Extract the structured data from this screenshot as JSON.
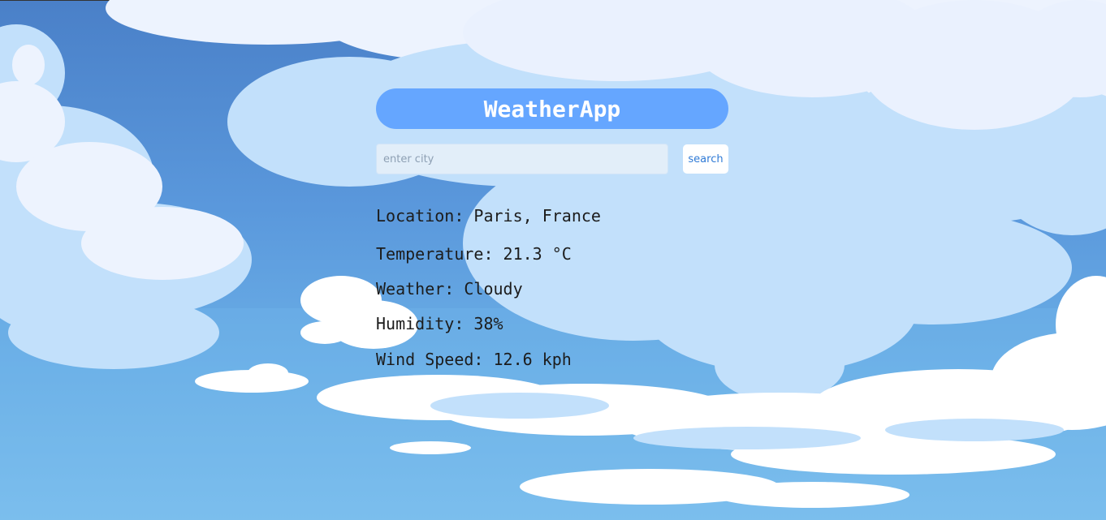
{
  "app": {
    "title": "WeatherApp"
  },
  "search": {
    "placeholder": "enter city",
    "value": "",
    "button_label": "search"
  },
  "weather": {
    "location_label": "Location:",
    "location_value": "Paris, France",
    "temperature_label": "Temperature:",
    "temperature_value": "21.3 °C",
    "condition_label": "Weather:",
    "condition_value": "Cloudy",
    "humidity_label": "Humidity:",
    "humidity_value": "38%",
    "wind_label": "Wind Speed:",
    "wind_value": "12.6 kph"
  },
  "colors": {
    "sky_top": "#4a80c8",
    "sky_bottom": "#80c2ef",
    "cloud_light": "#c2e0fb",
    "cloud_white": "#edf3fe",
    "title_bar": "#5a9bff",
    "button_text": "#2f7ad6"
  }
}
